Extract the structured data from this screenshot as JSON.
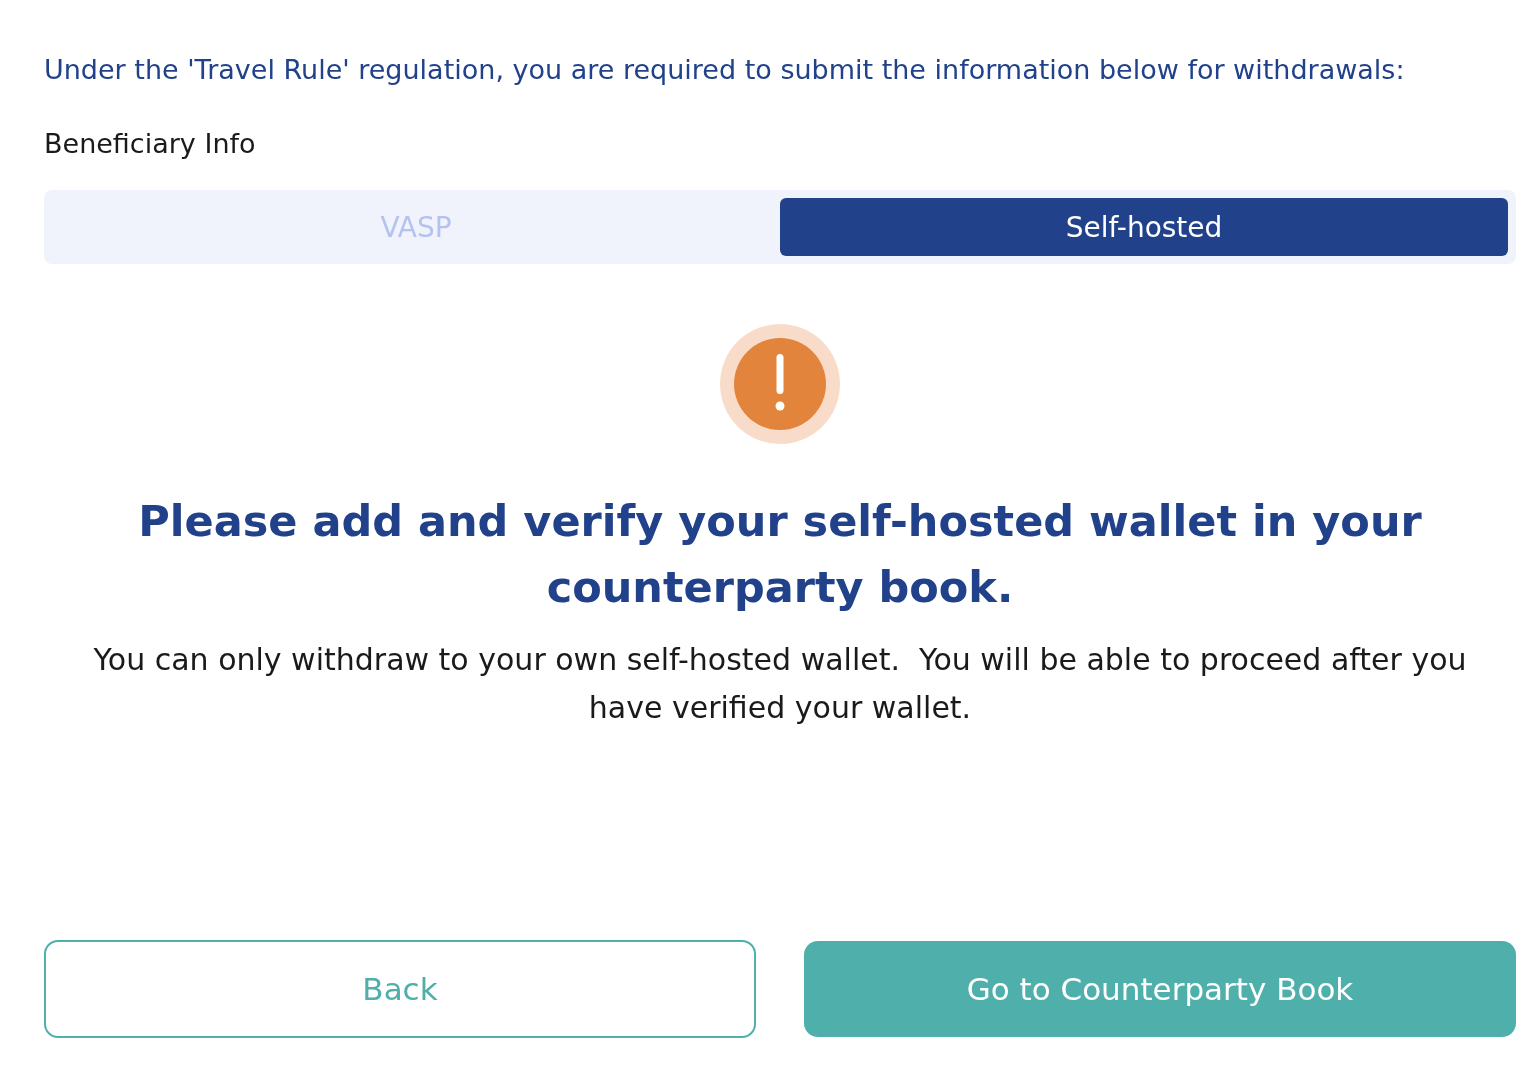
{
  "notice": "Under the 'Travel Rule' regulation, you are required to submit the information below for withdrawals:",
  "section_label": "Beneficiary Info",
  "tabs": [
    {
      "label": "VASP",
      "selected": false
    },
    {
      "label": "Self-hosted",
      "selected": true
    }
  ],
  "message": {
    "heading": "Please add and verify your self-hosted wallet in your counterparty book.",
    "body": "You can only withdraw to your own self-hosted wallet.  You will be able to proceed after you have verified your wallet."
  },
  "buttons": [
    {
      "label": "Back",
      "kind": "outline"
    },
    {
      "label": "Go to Counterparty Book",
      "kind": "filled"
    }
  ]
}
